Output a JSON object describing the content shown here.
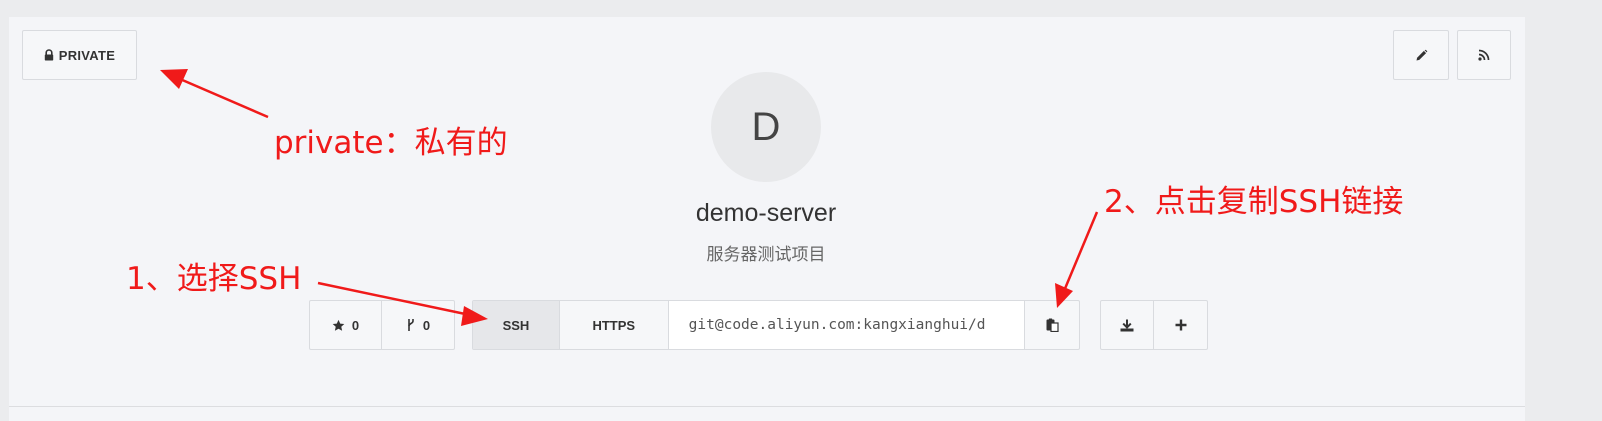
{
  "header": {
    "visibility_label": "PRIVATE",
    "icons": {
      "visibility": "lock-icon",
      "edit": "pencil-icon",
      "feed": "rss-icon"
    }
  },
  "repo": {
    "avatar_letter": "D",
    "name": "demo-server",
    "description": "服务器测试项目"
  },
  "stats": {
    "stars": "0",
    "forks": "0",
    "icons": {
      "stars": "star-icon",
      "forks": "fork-icon"
    }
  },
  "clone": {
    "tabs": [
      {
        "label": "SSH",
        "selected": true
      },
      {
        "label": "HTTPS",
        "selected": false
      }
    ],
    "url": "git@code.aliyun.com:kangxianghui/d",
    "icons": {
      "copy": "clipboard-icon",
      "download": "download-icon",
      "add": "plus-icon"
    }
  },
  "annotations": {
    "private_note": "private：私有的",
    "ssh_note": "1、选择SSH",
    "copy_note": "2、点击复制SSH链接",
    "color": "#f01a1a"
  },
  "colors": {
    "page_bg": "#ebecee",
    "panel_bg": "#f4f5f8",
    "button_bg": "#f6f7f9",
    "selected_tab_bg": "#e6e7ea",
    "border": "#d9dbdf"
  }
}
